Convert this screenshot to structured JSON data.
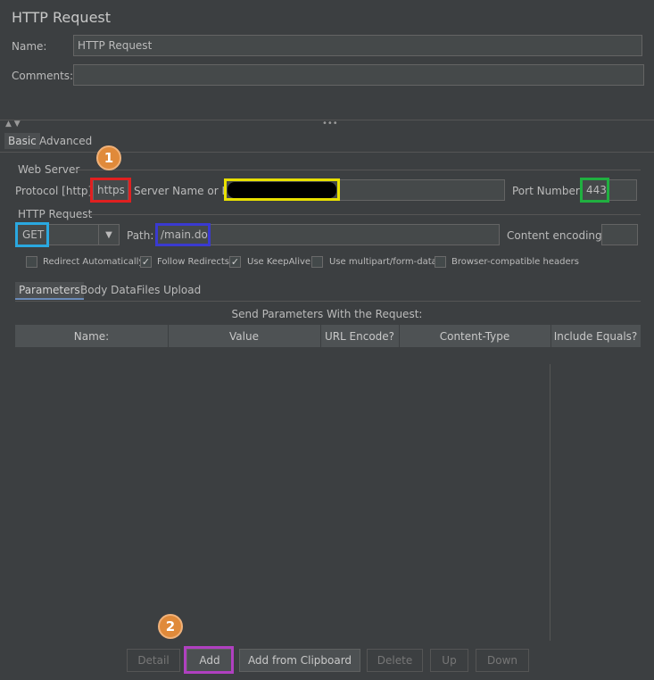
{
  "panel": {
    "title": "HTTP Request",
    "name_label": "Name:",
    "name_value": "HTTP Request",
    "comments_label": "Comments:",
    "comments_value": ""
  },
  "tabs": [
    "Basic",
    "Advanced"
  ],
  "web_server": {
    "section": "Web Server",
    "protocol_label": "Protocol [http]:",
    "protocol_value": "https",
    "server_label": "Server Name or IP:",
    "server_value": "",
    "port_label": "Port Number:",
    "port_value": "443"
  },
  "http_request": {
    "section": "HTTP Request",
    "method": "GET",
    "path_label": "Path:",
    "path_value": "/main.do",
    "encoding_label": "Content encoding:",
    "encoding_value": ""
  },
  "options": [
    {
      "label": "Redirect Automatically",
      "checked": false
    },
    {
      "label": "Follow Redirects",
      "checked": true
    },
    {
      "label": "Use KeepAlive",
      "checked": true
    },
    {
      "label": "Use multipart/form-data",
      "checked": false
    },
    {
      "label": "Browser-compatible headers",
      "checked": false
    }
  ],
  "sub_tabs": [
    "Parameters",
    "Body Data",
    "Files Upload"
  ],
  "params_table": {
    "caption": "Send Parameters With the Request:",
    "columns": [
      "Name:",
      "Value",
      "URL Encode?",
      "Content-Type",
      "Include Equals?"
    ]
  },
  "buttons": [
    "Detail",
    "Add",
    "Add from Clipboard",
    "Delete",
    "Up",
    "Down"
  ],
  "annotations": [
    "1",
    "2"
  ],
  "colors": {
    "highlight_protocol": "#e02020",
    "highlight_server": "#e8e000",
    "highlight_port": "#20b040",
    "highlight_method": "#2aa8e0",
    "highlight_path": "#3a3ad0",
    "highlight_add": "#b040c0",
    "badge": "#e08a3a"
  }
}
